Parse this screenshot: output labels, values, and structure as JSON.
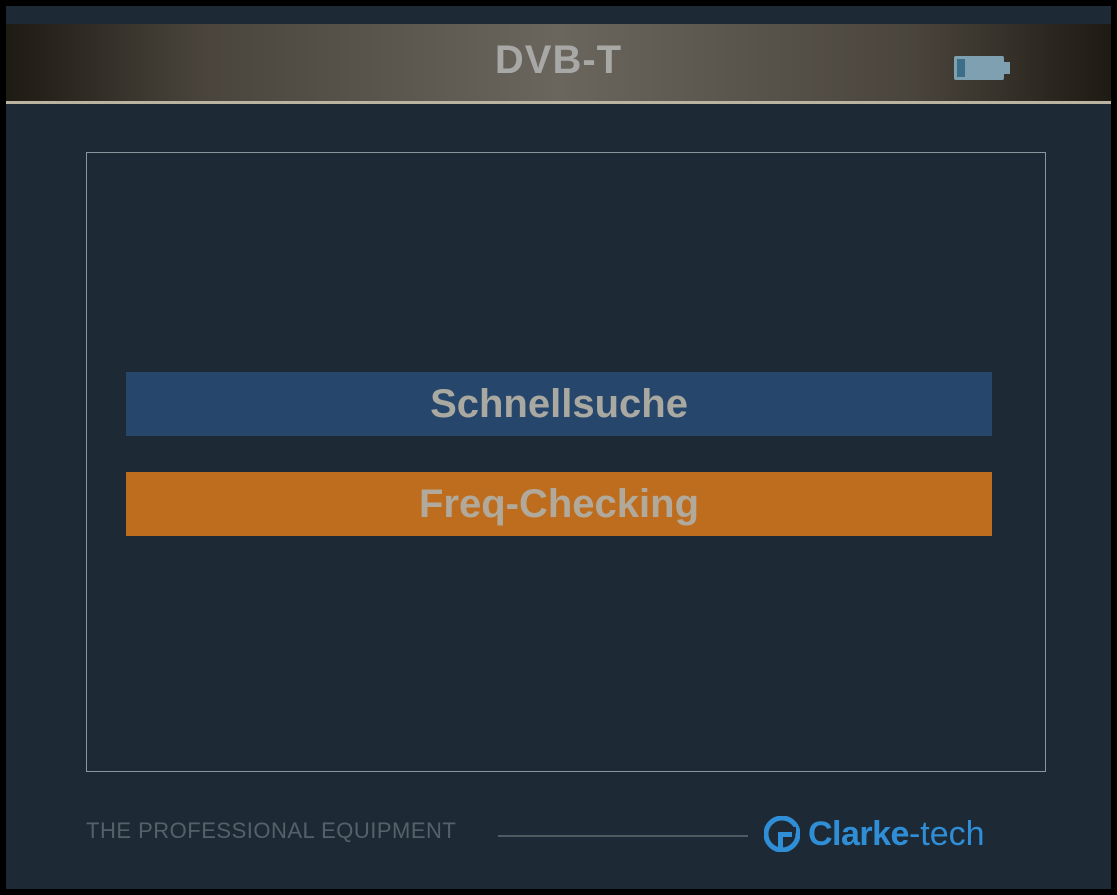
{
  "header": {
    "title": "DVB-T",
    "battery_icon": "battery-icon"
  },
  "menu": {
    "items": [
      {
        "label": "Schnellsuche",
        "state": "normal",
        "color": "#27466b"
      },
      {
        "label": "Freq-Checking",
        "state": "selected",
        "color": "#bd6d1d"
      }
    ]
  },
  "footer": {
    "tagline": "THE PROFESSIONAL EQUIPMENT",
    "brand_name": "Clarke",
    "brand_suffix": "-tech",
    "brand_color": "#2f8ed6",
    "brand_icon": "clarke-tech-logo-icon"
  }
}
